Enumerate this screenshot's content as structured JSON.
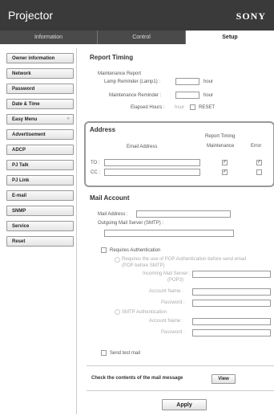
{
  "header": {
    "title": "Projector",
    "brand": "SONY"
  },
  "tabs": [
    {
      "label": "Information"
    },
    {
      "label": "Control"
    },
    {
      "label": "Setup"
    }
  ],
  "sidebar": {
    "items": [
      {
        "label": "Owner information"
      },
      {
        "label": "Network"
      },
      {
        "label": "Password"
      },
      {
        "label": "Date & Time"
      },
      {
        "label": "Easy Menu",
        "chevron": "»"
      },
      {
        "label": "Advertisement"
      },
      {
        "label": "ADCP"
      },
      {
        "label": "PJ Talk"
      },
      {
        "label": "PJ Link"
      },
      {
        "label": "E-mail"
      },
      {
        "label": "SNMP"
      },
      {
        "label": "Service"
      },
      {
        "label": "Reset"
      }
    ]
  },
  "report_timing": {
    "title": "Report Timing",
    "maintenance_report": "Maintenance Report",
    "lamp_reminder_label": "Lamp Reminder (Lamp1) :",
    "lamp_reminder_value": "",
    "lamp_unit": "hour",
    "maintenance_reminder_label": "Maintenance Reminder :",
    "maintenance_reminder_value": "",
    "maint_unit": "hour",
    "elapsed_hours_label": "Elapsed Hours :",
    "elapsed_unit": "hour",
    "reset_label": "RESET"
  },
  "address": {
    "title": "Address",
    "report_timing_header": "Report Timing",
    "email_address_header": "Email Address",
    "maintenance_header": "Maintenance",
    "error_header": "Error",
    "to_label": "TO :",
    "cc_label": "CC :",
    "to_value": "",
    "cc_value": "",
    "to_maintenance_checked": "✓",
    "to_error_checked": "✓",
    "cc_maintenance_checked": "✓",
    "cc_error_checked": ""
  },
  "mail_account": {
    "title": "Mail Account",
    "mail_address_label": "Mail Address :",
    "mail_address_value": "",
    "smtp_label": "Outgoing Mail Server (SMTP) :",
    "smtp_value": "",
    "requires_auth_label": "Requires Authentication",
    "pop_auth_label_1": "Requires the use of POP Authentication before send email",
    "pop_auth_label_2": "(POP before SMTP)",
    "incoming_server_label_1": "Incoming Mail Server :",
    "incoming_server_label_2": "(POP3)",
    "pop_account_label": "Account Name :",
    "pop_password_label": "Password :",
    "smtp_auth_label": "SMTP Authentication",
    "smtp_account_label": "Account Name :",
    "smtp_password_label": "Password :",
    "send_test_label": "Send test mail"
  },
  "check_contents": {
    "label": "Check the contents of the mail message",
    "view_button": "View"
  },
  "apply_button": "Apply"
}
